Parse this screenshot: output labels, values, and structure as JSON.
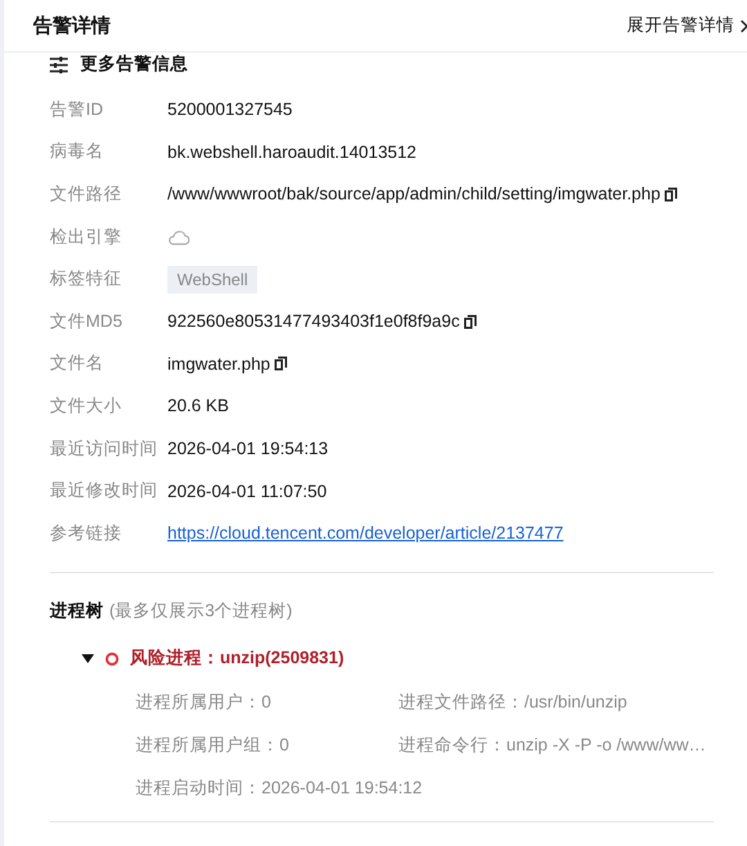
{
  "header": {
    "title": "告警详情",
    "expand_link": "展开告警详情"
  },
  "section": {
    "title": "更多告警信息"
  },
  "fields": [
    {
      "label": "告警ID",
      "kind": "text",
      "value": "5200001327545"
    },
    {
      "label": "病毒名",
      "kind": "text",
      "value": "bk.webshell.haroaudit.14013512"
    },
    {
      "label": "文件路径",
      "kind": "copyable",
      "value": "/www/wwwroot/bak/source/app/admin/child/setting/imgwater.php"
    },
    {
      "label": "检出引擎",
      "kind": "icon"
    },
    {
      "label": "标签特征",
      "kind": "tag",
      "value": "WebShell"
    },
    {
      "label": "文件MD5",
      "kind": "copyable",
      "value": "922560e80531477493403f1e0f8f9a9c"
    },
    {
      "label": "文件名",
      "kind": "copyable",
      "value": "imgwater.php"
    },
    {
      "label": "文件大小",
      "kind": "text",
      "value": "20.6 KB"
    },
    {
      "label": "最近访问时间",
      "kind": "text",
      "value": "2026-04-01 19:54:13"
    },
    {
      "label": "最近修改时间",
      "kind": "text",
      "value": "2026-04-01 11:07:50"
    },
    {
      "label": "参考链接",
      "kind": "link",
      "value": "https://cloud.tencent.com/developer/article/2137477"
    }
  ],
  "process_tree": {
    "title": "进程树",
    "note": "(最多仅展示3个进程树)",
    "nodes": [
      {
        "label": "风险进程：unzip(2509831)",
        "expanded": true,
        "details": [
          "进程所属用户：0",
          "进程文件路径：/usr/bin/unzip",
          "进程所属用户组：0",
          "进程命令行：unzip -X -P -o /www/ww…",
          "进程启动时间：2026-04-01 19:54:12"
        ]
      }
    ]
  }
}
